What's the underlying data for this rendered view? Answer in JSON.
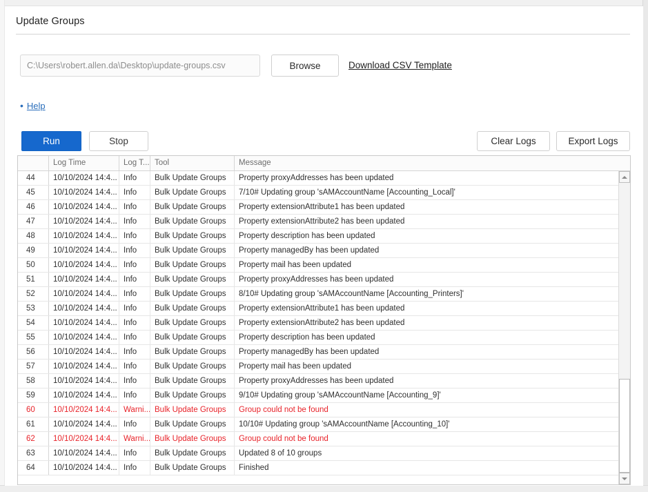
{
  "window": {
    "title": "Update Groups"
  },
  "file_row": {
    "path_value": "C:\\Users\\robert.allen.da\\Desktop\\update-groups.csv",
    "path_placeholder": "C:\\Users\\robert.allen.da\\Desktop\\update-groups.csv",
    "browse_label": "Browse",
    "download_template_label": "Download CSV Template"
  },
  "help": {
    "bullet": "•",
    "label": "Help"
  },
  "actions": {
    "run_label": "Run",
    "stop_label": "Stop",
    "clear_logs_label": "Clear Logs",
    "export_logs_label": "Export Logs"
  },
  "colors": {
    "run_button_bg": "#1668cd",
    "link_blue": "#2a6ebb",
    "warning_red": "#e8232a",
    "grid_border": "#c9c9c9"
  },
  "log_grid": {
    "columns": [
      {
        "key": "index",
        "label": ""
      },
      {
        "key": "log_time",
        "label": "Log Time"
      },
      {
        "key": "log_type",
        "label": "Log T..."
      },
      {
        "key": "tool",
        "label": "Tool"
      },
      {
        "key": "message",
        "label": "Message"
      }
    ],
    "scrollbar": {
      "up_icon": "triangle-up",
      "down_icon": "triangle-down",
      "thumb_position": "near-bottom"
    },
    "rows": [
      {
        "index": "44",
        "log_time": "10/10/2024 14:4...",
        "log_type": "Info",
        "tool": "Bulk Update Groups",
        "message": "Property proxyAddresses has been updated",
        "level": "info"
      },
      {
        "index": "45",
        "log_time": "10/10/2024 14:4...",
        "log_type": "Info",
        "tool": "Bulk Update Groups",
        "message": "7/10# Updating group 'sAMAccountName [Accounting_Local]'",
        "level": "info"
      },
      {
        "index": "46",
        "log_time": "10/10/2024 14:4...",
        "log_type": "Info",
        "tool": "Bulk Update Groups",
        "message": "Property extensionAttribute1 has been updated",
        "level": "info"
      },
      {
        "index": "47",
        "log_time": "10/10/2024 14:4...",
        "log_type": "Info",
        "tool": "Bulk Update Groups",
        "message": "Property extensionAttribute2 has been updated",
        "level": "info"
      },
      {
        "index": "48",
        "log_time": "10/10/2024 14:4...",
        "log_type": "Info",
        "tool": "Bulk Update Groups",
        "message": "Property description has been updated",
        "level": "info"
      },
      {
        "index": "49",
        "log_time": "10/10/2024 14:4...",
        "log_type": "Info",
        "tool": "Bulk Update Groups",
        "message": "Property managedBy has been updated",
        "level": "info"
      },
      {
        "index": "50",
        "log_time": "10/10/2024 14:4...",
        "log_type": "Info",
        "tool": "Bulk Update Groups",
        "message": "Property mail has been updated",
        "level": "info"
      },
      {
        "index": "51",
        "log_time": "10/10/2024 14:4...",
        "log_type": "Info",
        "tool": "Bulk Update Groups",
        "message": "Property proxyAddresses has been updated",
        "level": "info"
      },
      {
        "index": "52",
        "log_time": "10/10/2024 14:4...",
        "log_type": "Info",
        "tool": "Bulk Update Groups",
        "message": "8/10# Updating group 'sAMAccountName [Accounting_Printers]'",
        "level": "info"
      },
      {
        "index": "53",
        "log_time": "10/10/2024 14:4...",
        "log_type": "Info",
        "tool": "Bulk Update Groups",
        "message": "Property extensionAttribute1 has been updated",
        "level": "info"
      },
      {
        "index": "54",
        "log_time": "10/10/2024 14:4...",
        "log_type": "Info",
        "tool": "Bulk Update Groups",
        "message": "Property extensionAttribute2 has been updated",
        "level": "info"
      },
      {
        "index": "55",
        "log_time": "10/10/2024 14:4...",
        "log_type": "Info",
        "tool": "Bulk Update Groups",
        "message": "Property description has been updated",
        "level": "info"
      },
      {
        "index": "56",
        "log_time": "10/10/2024 14:4...",
        "log_type": "Info",
        "tool": "Bulk Update Groups",
        "message": "Property managedBy has been updated",
        "level": "info"
      },
      {
        "index": "57",
        "log_time": "10/10/2024 14:4...",
        "log_type": "Info",
        "tool": "Bulk Update Groups",
        "message": "Property mail has been updated",
        "level": "info"
      },
      {
        "index": "58",
        "log_time": "10/10/2024 14:4...",
        "log_type": "Info",
        "tool": "Bulk Update Groups",
        "message": "Property proxyAddresses has been updated",
        "level": "info"
      },
      {
        "index": "59",
        "log_time": "10/10/2024 14:4...",
        "log_type": "Info",
        "tool": "Bulk Update Groups",
        "message": "9/10# Updating group 'sAMAccountName [Accounting_9]'",
        "level": "info"
      },
      {
        "index": "60",
        "log_time": "10/10/2024 14:4...",
        "log_type": "Warni...",
        "tool": "Bulk Update Groups",
        "message": "Group could not be found",
        "level": "warning"
      },
      {
        "index": "61",
        "log_time": "10/10/2024 14:4...",
        "log_type": "Info",
        "tool": "Bulk Update Groups",
        "message": "10/10# Updating group 'sAMAccountName [Accounting_10]'",
        "level": "info"
      },
      {
        "index": "62",
        "log_time": "10/10/2024 14:4...",
        "log_type": "Warni...",
        "tool": "Bulk Update Groups",
        "message": "Group could not be found",
        "level": "warning"
      },
      {
        "index": "63",
        "log_time": "10/10/2024 14:4...",
        "log_type": "Info",
        "tool": "Bulk Update Groups",
        "message": "Updated 8 of 10 groups",
        "level": "info"
      },
      {
        "index": "64",
        "log_time": "10/10/2024 14:4...",
        "log_type": "Info",
        "tool": "Bulk Update Groups",
        "message": "Finished",
        "level": "info"
      }
    ]
  }
}
